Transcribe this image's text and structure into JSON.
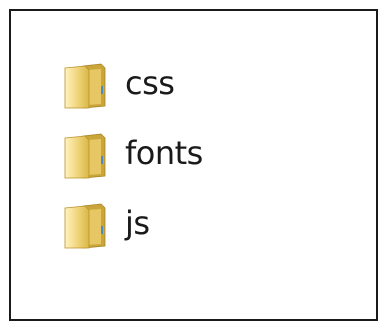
{
  "folders": [
    {
      "name": "css",
      "icon": "folder-icon"
    },
    {
      "name": "fonts",
      "icon": "folder-icon"
    },
    {
      "name": "js",
      "icon": "folder-icon"
    }
  ],
  "colors": {
    "folder_back": "#d9b846",
    "folder_front": "#f5dd8a",
    "folder_front_light": "#fff3c2",
    "folder_edge": "#b99128",
    "text": "#1a1a1a",
    "border": "#1a1a1a"
  }
}
